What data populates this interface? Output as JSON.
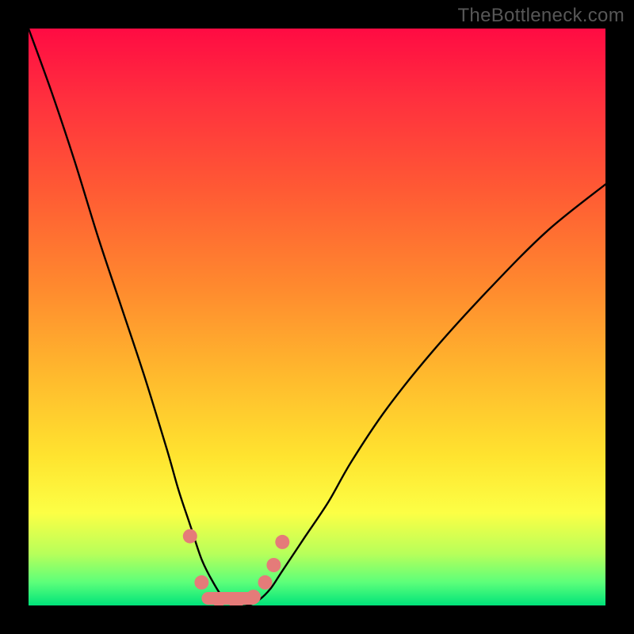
{
  "watermark": {
    "text": "TheBottleneck.com"
  },
  "colors": {
    "frame": "#000000",
    "gradient_top": "#ff0b43",
    "gradient_bottom": "#00e37a",
    "curve": "#000000",
    "markers": "#e57b79"
  },
  "chart_data": {
    "type": "line",
    "title": "",
    "xlabel": "",
    "ylabel": "",
    "xlim": [
      0,
      100
    ],
    "ylim": [
      0,
      100
    ],
    "grid": false,
    "legend": false,
    "axes_visible": false,
    "notes": "V-shaped bottleneck curve. y≈100 means worst (top, red); y≈0 means best (bottom, green). Minimum around x≈34–40. Axes are unlabeled in the image; values are pixel-derived estimates.",
    "series": [
      {
        "name": "bottleneck-curve",
        "x": [
          0,
          4,
          8,
          12,
          16,
          20,
          24,
          26,
          28,
          30,
          32,
          34,
          36,
          38,
          40,
          42,
          44,
          48,
          52,
          56,
          62,
          70,
          80,
          90,
          100
        ],
        "y": [
          100,
          89,
          77,
          64,
          52,
          40,
          27,
          20,
          14,
          8,
          4,
          1,
          0,
          0,
          1,
          3,
          6,
          12,
          18,
          25,
          34,
          44,
          55,
          65,
          73
        ]
      }
    ],
    "markers": [
      {
        "x": 28.0,
        "y": 12.0
      },
      {
        "x": 30.0,
        "y": 4.0
      },
      {
        "x": 33.0,
        "y": 1.0
      },
      {
        "x": 36.0,
        "y": 0.5
      },
      {
        "x": 39.0,
        "y": 1.5
      },
      {
        "x": 41.0,
        "y": 4.0
      },
      {
        "x": 42.5,
        "y": 7.0
      },
      {
        "x": 44.0,
        "y": 11.0
      }
    ],
    "bottom_bar": {
      "x_start": 30,
      "x_end": 40,
      "thickness_pct": 2.2
    }
  }
}
